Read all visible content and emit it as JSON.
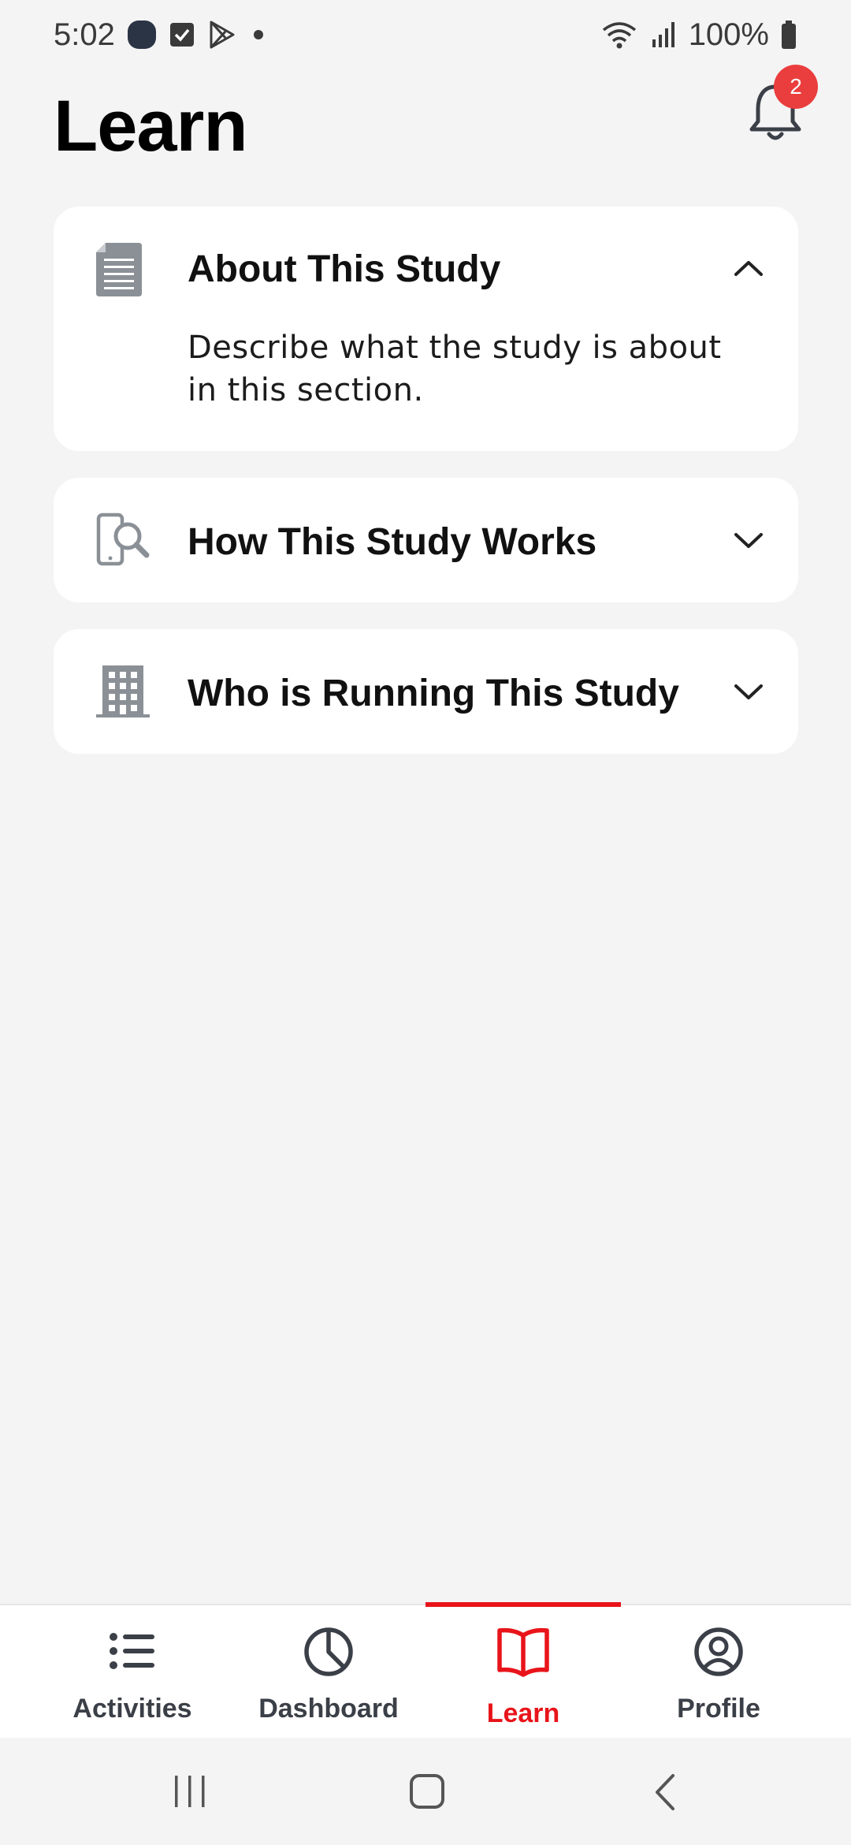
{
  "status_bar": {
    "time": "5:02",
    "battery": "100%"
  },
  "header": {
    "title": "Learn",
    "notification_count": "2"
  },
  "sections": [
    {
      "title": "About This Study",
      "icon": "document-icon",
      "expanded": true,
      "body": "Describe what the study is about in this section."
    },
    {
      "title": "How This Study Works",
      "icon": "phone-search-icon",
      "expanded": false
    },
    {
      "title": "Who is Running This Study",
      "icon": "building-icon",
      "expanded": false
    }
  ],
  "bottom_nav": {
    "items": [
      {
        "label": "Activities",
        "icon": "list-icon"
      },
      {
        "label": "Dashboard",
        "icon": "pie-chart-icon"
      },
      {
        "label": "Learn",
        "icon": "book-icon"
      },
      {
        "label": "Profile",
        "icon": "user-circle-icon"
      }
    ],
    "active_index": 2
  },
  "colors": {
    "accent": "#e8141a",
    "badge": "#ea3d3d",
    "background": "#f4f4f5",
    "card": "#ffffff",
    "icon_gray": "#8a9096"
  }
}
